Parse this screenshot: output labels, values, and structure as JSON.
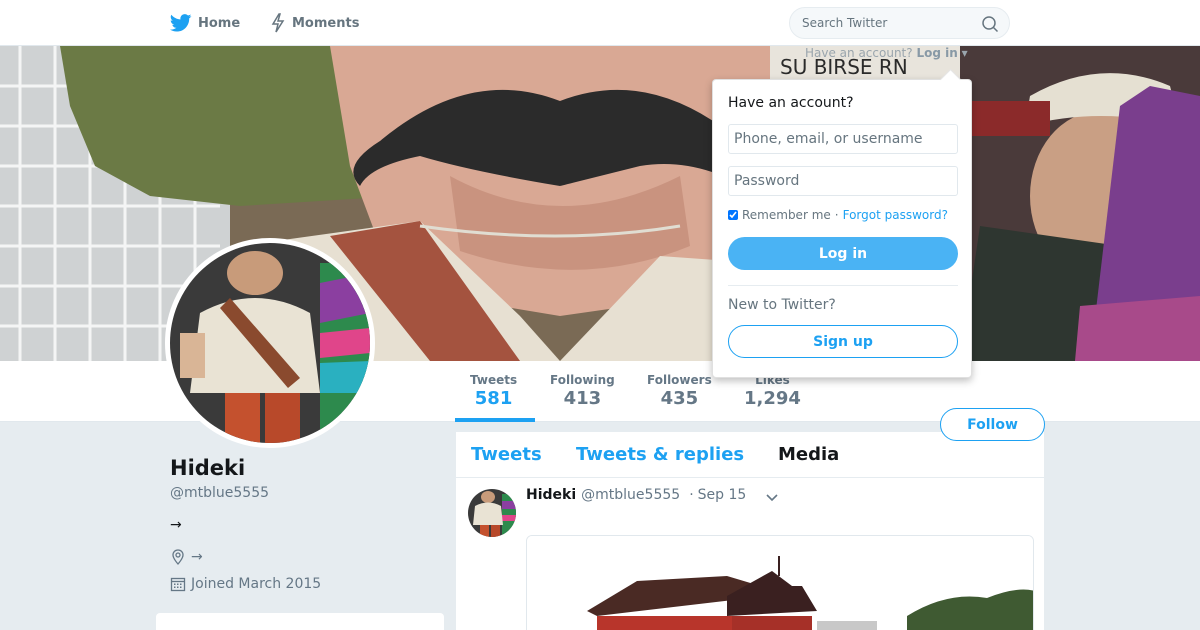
{
  "nav": {
    "home_label": "Home",
    "moments_label": "Moments",
    "search_placeholder": "Search Twitter",
    "brand_color": "#1da1f2"
  },
  "login_toggle": {
    "prefix": "Have an account?",
    "label": "Log in"
  },
  "login_dropdown": {
    "title": "Have an account?",
    "username_placeholder": "Phone, email, or username",
    "password_placeholder": "Password",
    "remember_label": "Remember me",
    "separator": "·",
    "forgot_label": "Forgot password?",
    "login_button": "Log in",
    "new_prompt": "New to Twitter?",
    "signup_button": "Sign up"
  },
  "profile": {
    "name": "Hideki",
    "handle": "@mtblue5555",
    "bio": "→",
    "location": "→",
    "joined": "Joined March 2015",
    "follow_button": "Follow"
  },
  "stats": [
    {
      "label": "Tweets",
      "value": "581"
    },
    {
      "label": "Following",
      "value": "413"
    },
    {
      "label": "Followers",
      "value": "435"
    },
    {
      "label": "Likes",
      "value": "1,294"
    }
  ],
  "tabs": [
    "Tweets",
    "Tweets & replies",
    "Media"
  ],
  "tweet": {
    "name": "Hideki",
    "handle": "@mtblue5555",
    "dot": "·",
    "date": "Sep 15"
  }
}
